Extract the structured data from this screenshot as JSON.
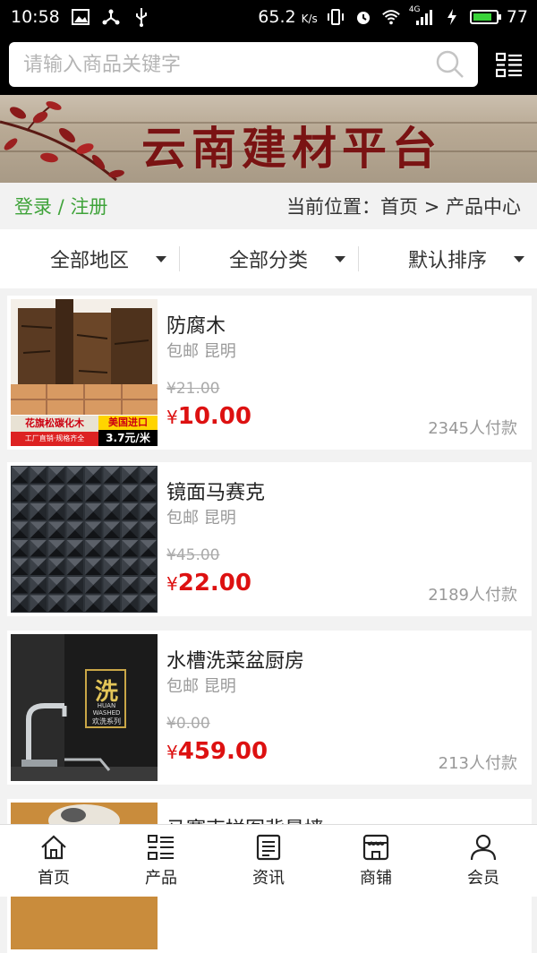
{
  "status_bar": {
    "time": "10:58",
    "speed": "65.2",
    "speed_unit": "K/s",
    "network": "4G",
    "battery": "77",
    "battery_level": 0.77
  },
  "search": {
    "placeholder": "请输入商品关键字",
    "value": ""
  },
  "banner": {
    "title": "云南建材平台"
  },
  "breadcrumb": {
    "login": "登录",
    "separator": " / ",
    "register": "注册",
    "location_label": "当前位置：",
    "home": "首页",
    "arrow": " > ",
    "current": "产品中心"
  },
  "filters": [
    {
      "label": "全部地区"
    },
    {
      "label": "全部分类"
    },
    {
      "label": "默认排序"
    }
  ],
  "products": [
    {
      "name": "防腐木",
      "shipping": "包邮 昆明",
      "old_price": "¥21.00",
      "price_symbol": "¥",
      "price": "10.00",
      "sales": "2345人付款",
      "image_text_1": "花旗松碳化木",
      "image_text_2": "美国进口",
      "image_text_3": "工厂直销·规格齐全",
      "image_text_4": "3.7元/米"
    },
    {
      "name": "镜面马赛克",
      "shipping": "包邮 昆明",
      "old_price": "¥45.00",
      "price_symbol": "¥",
      "price": "22.00",
      "sales": "2189人付款"
    },
    {
      "name": "水槽洗菜盆厨房",
      "shipping": "包邮 昆明",
      "old_price": "¥0.00",
      "price_symbol": "¥",
      "price": "459.00",
      "sales": "213人付款",
      "image_text_1": "洗",
      "image_text_2": "HUAN WASHED",
      "image_text_3": "欢洗系列"
    },
    {
      "name": "马赛克拼图背景墙"
    }
  ],
  "tabbar": [
    {
      "label": "首页",
      "icon": "home-icon"
    },
    {
      "label": "产品",
      "icon": "list-icon"
    },
    {
      "label": "资讯",
      "icon": "news-icon"
    },
    {
      "label": "商铺",
      "icon": "shop-icon"
    },
    {
      "label": "会员",
      "icon": "user-icon"
    }
  ],
  "colors": {
    "accent_green": "#3fa33a",
    "price_red": "#dd1111",
    "banner_text": "#7a1313"
  }
}
